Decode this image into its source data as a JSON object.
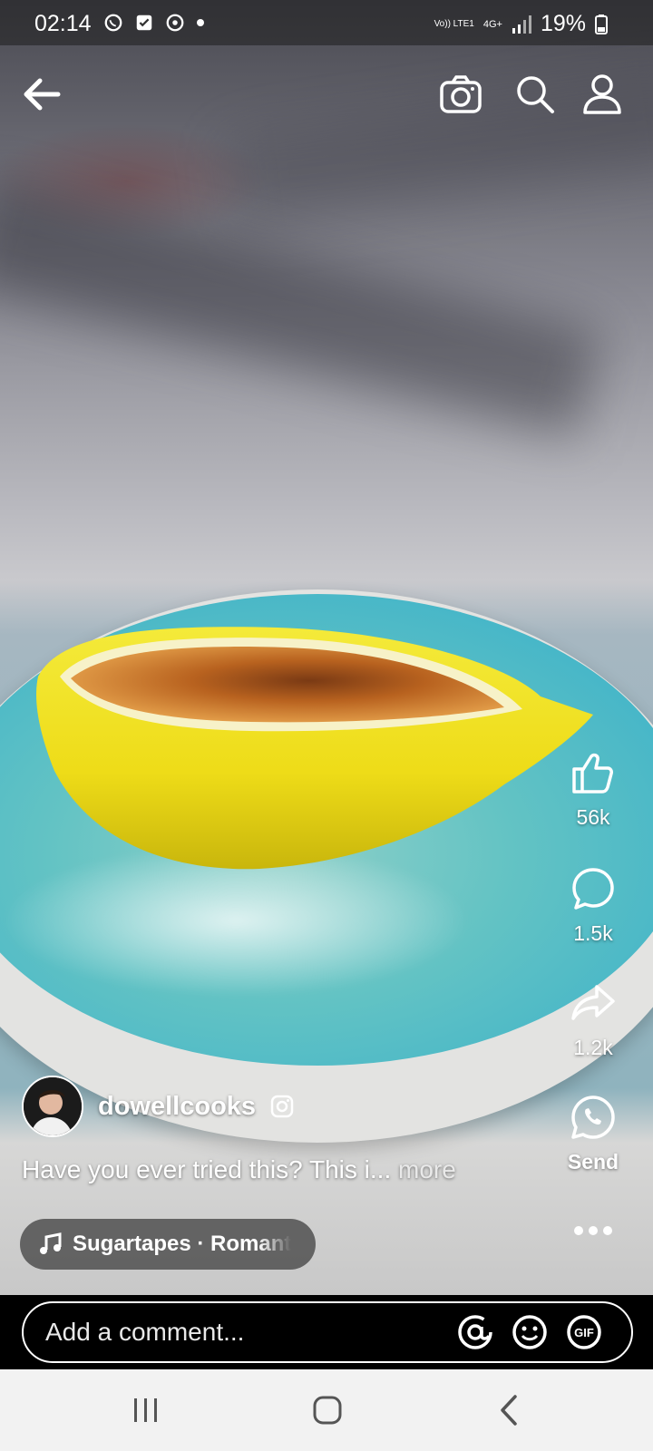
{
  "status_bar": {
    "time": "02:14",
    "carrier": "Vo)) LTE1",
    "network": "4G+",
    "battery": "19%"
  },
  "top_nav": {
    "back_icon": "back-arrow-icon",
    "camera_icon": "camera-icon",
    "search_icon": "search-icon",
    "profile_icon": "profile-icon"
  },
  "actions": {
    "likes": "56k",
    "comments": "1.5k",
    "shares": "1.2k",
    "send_label": "Send"
  },
  "post": {
    "author": "dowellcooks",
    "caption": "Have you ever tried this? This i...",
    "more": "more",
    "music": "Sugartapes · Romant"
  },
  "comment": {
    "placeholder": "Add a comment..."
  },
  "colors": {
    "plate": "#46b6c8",
    "lemon": "#f0e020",
    "brulee": "#b8621f"
  }
}
